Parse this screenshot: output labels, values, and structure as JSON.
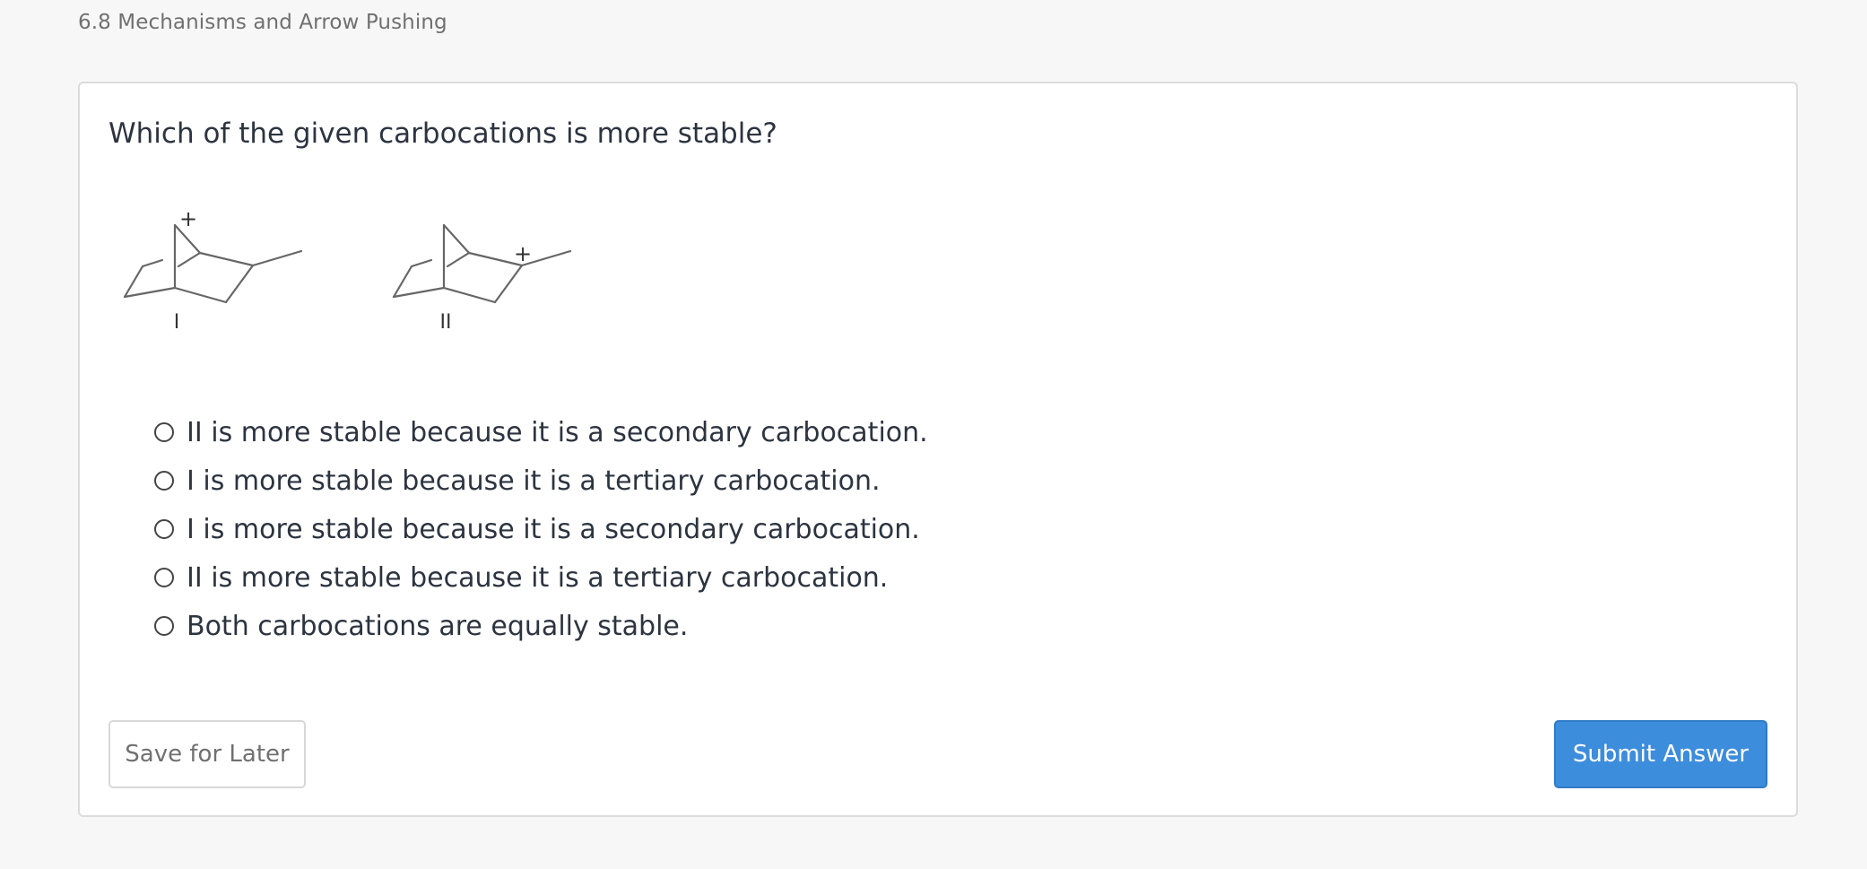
{
  "breadcrumb": "6.8 Mechanisms and Arrow Pushing",
  "question": {
    "text": "Which of the given carbocations is more stable?",
    "structures": [
      {
        "label": "I",
        "charge_symbol": "+"
      },
      {
        "label": "II",
        "charge_symbol": "+"
      }
    ]
  },
  "choices": [
    {
      "label": "II is more stable because it is a secondary carbocation.",
      "selected": false
    },
    {
      "label": "I is more stable because it is a tertiary carbocation.",
      "selected": false
    },
    {
      "label": "I is more stable because it is a secondary carbocation.",
      "selected": false
    },
    {
      "label": "II is more stable because it is a tertiary carbocation.",
      "selected": false
    },
    {
      "label": "Both carbocations are equally stable.",
      "selected": false
    }
  ],
  "buttons": {
    "save_label": "Save for Later",
    "submit_label": "Submit Answer"
  },
  "colors": {
    "submit_bg": "#3d8ddd",
    "background": "#f7f7f7"
  }
}
